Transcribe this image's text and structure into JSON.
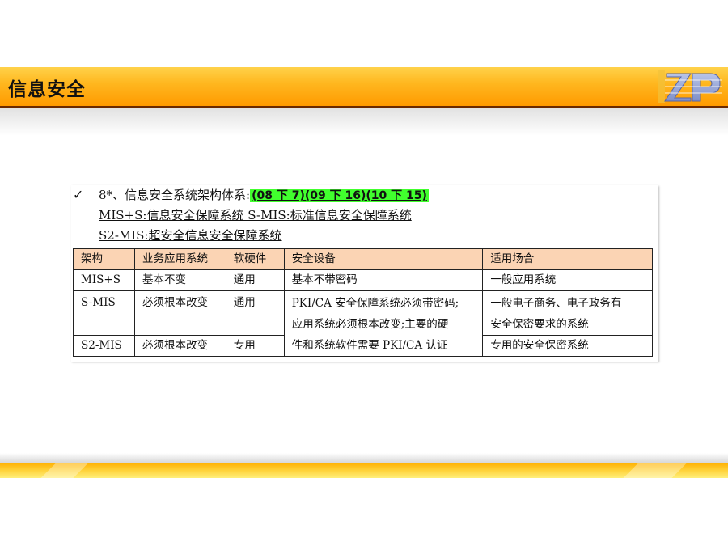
{
  "header": {
    "title": "信息安全"
  },
  "logo": {
    "text": "ZP"
  },
  "content": {
    "check_mark": "✓",
    "line1_prefix": "8*、信息安全系统架构体系:",
    "line1_highlight": "(08 下 7)(09 下 16)(10 下 15)",
    "line2": "MIS+S:信息安全保障系统 S-MIS:标准信息安全保障系统",
    "line3": "S2-MIS:超安全信息安全保障系统"
  },
  "table": {
    "headers": [
      "架构",
      "业务应用系统",
      "软硬件",
      "安全设备",
      "适用场合"
    ],
    "rows": [
      [
        "MIS+S",
        "基本不变",
        "通用",
        "基本不带密码",
        "一般应用系统"
      ],
      [
        "S-MIS",
        "必须根本改变",
        "通用",
        "PKI/CA 安全保障系统必须带密码;",
        "一般电子商务、电子政务有"
      ],
      [
        "",
        "",
        "",
        "应用系统必须根本改变;主要的硬",
        "安全保密要求的系统"
      ],
      [
        "S2-MIS",
        "必须根本改变",
        "专用",
        "件和系统软件需要 PKI/CA 认证",
        "专用的安全保密系统"
      ]
    ]
  },
  "colors": {
    "header_band": "#ffa500",
    "table_header_bg": "#fbd4b4",
    "highlight": "#41ff2e"
  }
}
